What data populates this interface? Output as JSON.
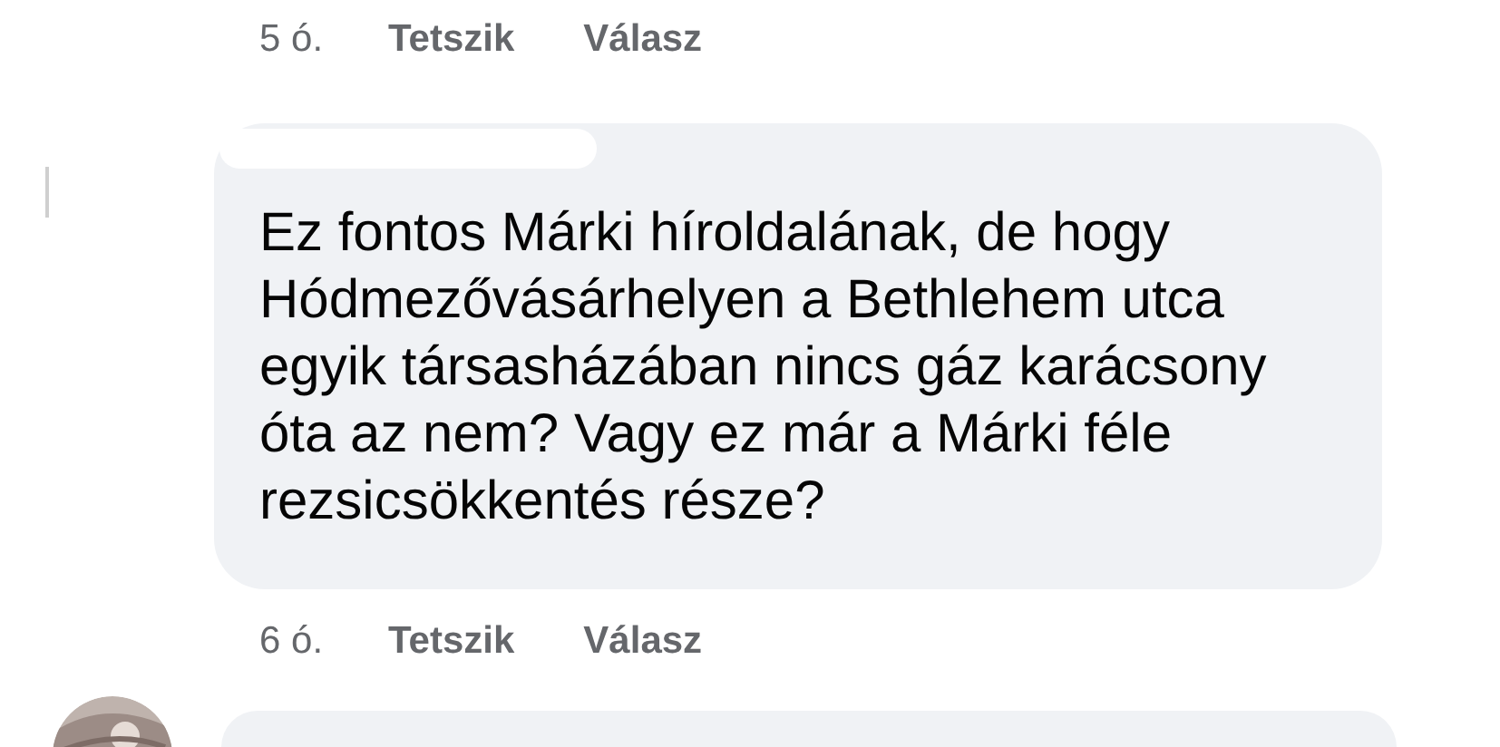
{
  "previous_comment": {
    "time": "5 ó.",
    "actions": [
      "Tetszik",
      "Válasz"
    ]
  },
  "comment": {
    "text": "Ez fontos Márki híroldalának, de hogy Hódmezővásárhelyen a Bethlehem utca egyik társasházában nincs gáz karácsony óta az nem? Vagy ez már a Márki féle rezsicsökkentés része?",
    "time": "6 ó.",
    "actions": [
      "Tetszik",
      "Válasz"
    ]
  }
}
